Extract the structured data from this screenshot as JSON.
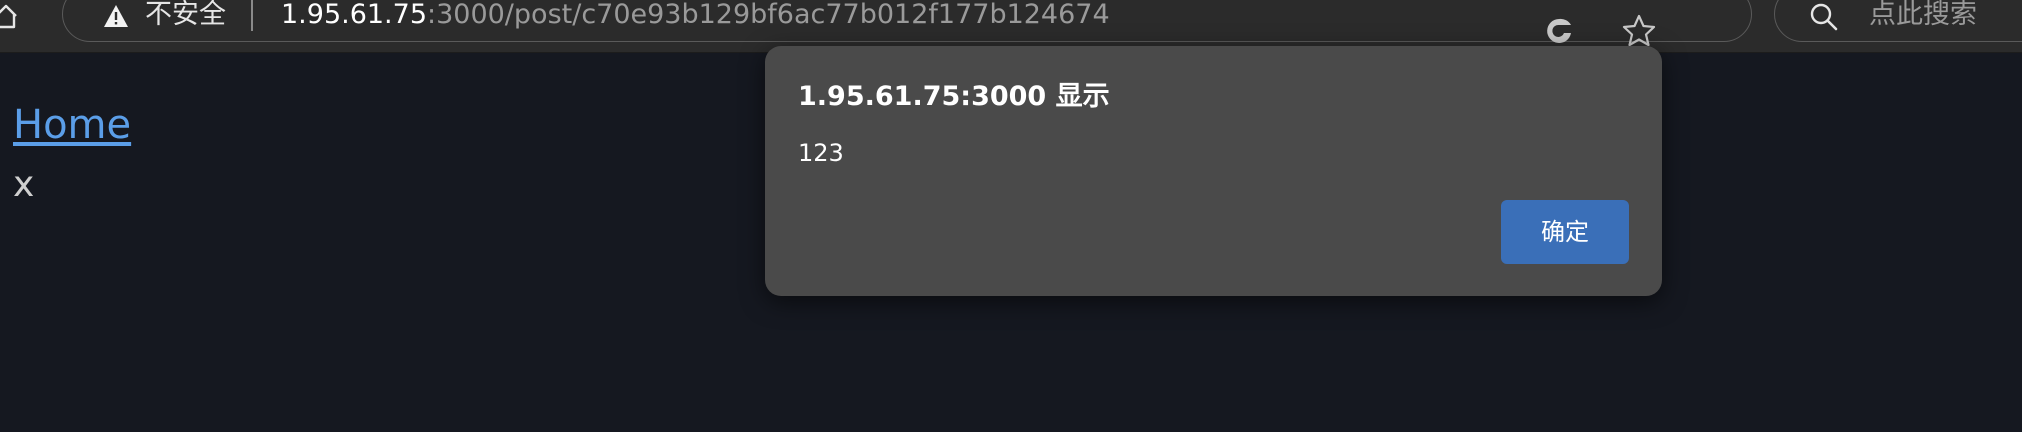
{
  "browser": {
    "security_label": "不安全",
    "url_host": "1.95.61.75",
    "url_path": ":3000/post/c70e93b129bf6ac77b012f177b124674",
    "search_placeholder": "点此搜索",
    "icons": [
      "home-icon",
      "warning-icon",
      "edge-extension-icon",
      "star-icon",
      "search-icon"
    ]
  },
  "page": {
    "home_link": "Home",
    "post_text": "x"
  },
  "alert": {
    "title": "1.95.61.75:3000 显示",
    "message": "123",
    "ok_label": "确定"
  },
  "colors": {
    "page_background": "#151820",
    "link": "#5b9ee8",
    "dialog_background": "#4a4a4a",
    "button": "#3a6fb8"
  }
}
